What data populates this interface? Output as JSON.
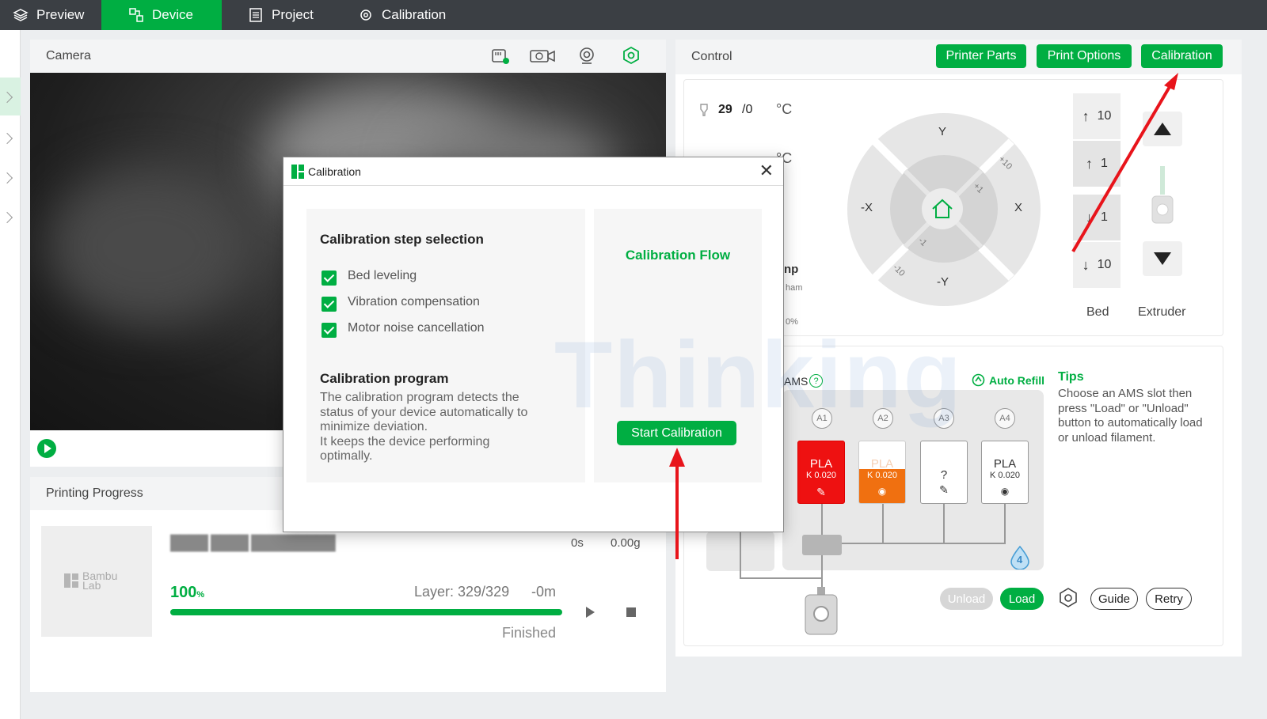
{
  "topbar": {
    "tabs": [
      {
        "label": "Preview"
      },
      {
        "label": "Device"
      },
      {
        "label": "Project"
      },
      {
        "label": "Calibration"
      }
    ]
  },
  "camera": {
    "title": "Camera"
  },
  "progress": {
    "title": "Printing Progress",
    "file_name": "████ ████ █████████",
    "time": "0s",
    "weight": "0.00g",
    "percent": "100",
    "percent_unit": "%",
    "layer": "Layer: 329/329",
    "remaining": "-0m",
    "status": "Finished",
    "progress_fraction": 1.0,
    "thumb_logo": [
      "Bambu",
      "Lab"
    ]
  },
  "control": {
    "title": "Control",
    "buttons": {
      "printer_parts": "Printer Parts",
      "print_options": "Print Options",
      "calibration": "Calibration"
    },
    "nozzle_temp_current": "29",
    "nozzle_temp_target": "/0",
    "temp_unit": "°C",
    "bed_temp_unit": "°C",
    "dpad": {
      "y_plus": "Y",
      "y_minus": "-Y",
      "x_plus": "X",
      "x_minus": "-X",
      "plus10": "+10",
      "plus1": "+1",
      "minus1": "-1",
      "minus10": "-10"
    },
    "bed_steps": [
      "10",
      "1",
      "1",
      "10"
    ],
    "bed_label": "Bed",
    "extruder_label": "Extruder",
    "partial_labels": {
      "np": "np",
      "ham": "ham",
      "fan_pct": "0%"
    }
  },
  "ams": {
    "title": "AMS",
    "help": "?",
    "auto_refill": "Auto Refill",
    "tips_title": "Tips",
    "tips_text": "Choose an AMS slot then press \"Load\" or \"Unload\" button to automatically load or unload filament.",
    "slot_labels": [
      "A1",
      "A2",
      "A3",
      "A4"
    ],
    "slots": [
      {
        "material": "PLA",
        "k": "K 0.020",
        "color": "#ee1111",
        "text_color": "#ffffff"
      },
      {
        "material": "PLA",
        "k": "K 0.020",
        "color": "#f07010",
        "text_color": "#ffffff"
      },
      {
        "material": "?",
        "k": "",
        "color": "#ffffff",
        "text_color": "#333333"
      },
      {
        "material": "PLA",
        "k": "K 0.020",
        "color": "#ffffff",
        "text_color": "#333333"
      }
    ],
    "badge": "4",
    "unload": "Unload",
    "load": "Load",
    "guide": "Guide",
    "retry": "Retry"
  },
  "dialog": {
    "title": "Calibration",
    "close": "✕",
    "section_title": "Calibration step selection",
    "steps": [
      {
        "label": "Bed leveling",
        "checked": true
      },
      {
        "label": "Vibration compensation",
        "checked": true
      },
      {
        "label": "Motor noise cancellation",
        "checked": true
      }
    ],
    "program_title": "Calibration program",
    "program_text_1": "The calibration program detects the",
    "program_text_2": "status of your device automatically to",
    "program_text_3": "minimize deviation.",
    "program_text_4": "It keeps the device performing",
    "program_text_5": "optimally.",
    "flow_title": "Calibration Flow",
    "start_button": "Start Calibration"
  },
  "watermark": "Thinking",
  "colors": {
    "accent": "#00ae42",
    "topbar": "#3b3f44",
    "annotation_arrow": "#e8141b"
  }
}
